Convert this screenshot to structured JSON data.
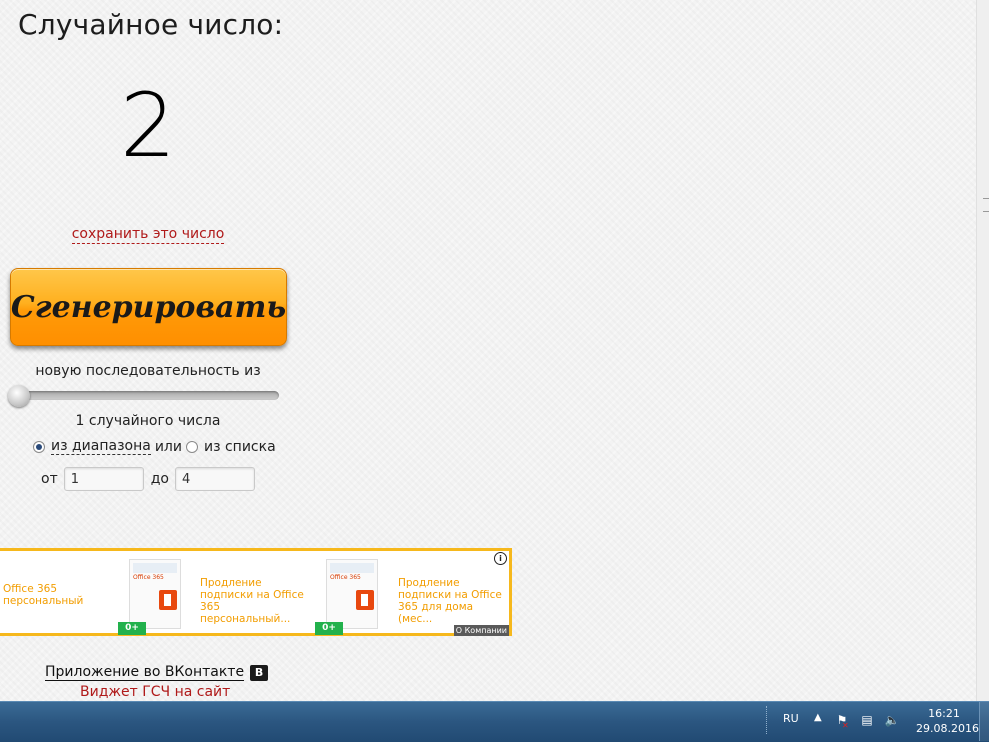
{
  "page": {
    "title": "Случайное число:",
    "result": "2",
    "save_link": "сохранить это число",
    "generate_button": "Сгенерировать",
    "sequence_label": "новую последовательность из",
    "count_label": "1 случайного числа",
    "slider_value": 1,
    "mode": {
      "range_label": "из диапазона",
      "or_label": "или",
      "list_label": "из списка",
      "selected": "range"
    },
    "range": {
      "from_label": "от",
      "from_value": "1",
      "to_label": "до",
      "to_value": "4"
    },
    "vk_app_link": "Приложение во ВКонтакте",
    "vk_badge": "В",
    "widget_link": "Виджет ГСЧ на сайт"
  },
  "ad": {
    "item1_text": "Office 365 персональный",
    "item2_text": "Продление подписки на Office 365 персональный...",
    "item3_text": "Продление подписки на Office 365 для дома (мес...",
    "product1_label": "Office 365",
    "product2_label": "Office 365",
    "age_badge": "0+",
    "about": "О Компании",
    "info_icon_label": "i",
    "accent_color": "#f6b81c",
    "text_color": "#f29d00"
  },
  "taskbar": {
    "language": "RU",
    "time": "16:21",
    "date": "29.08.2016"
  },
  "colors": {
    "link_red": "#b01a1a",
    "button_orange": "#ff9a08"
  }
}
